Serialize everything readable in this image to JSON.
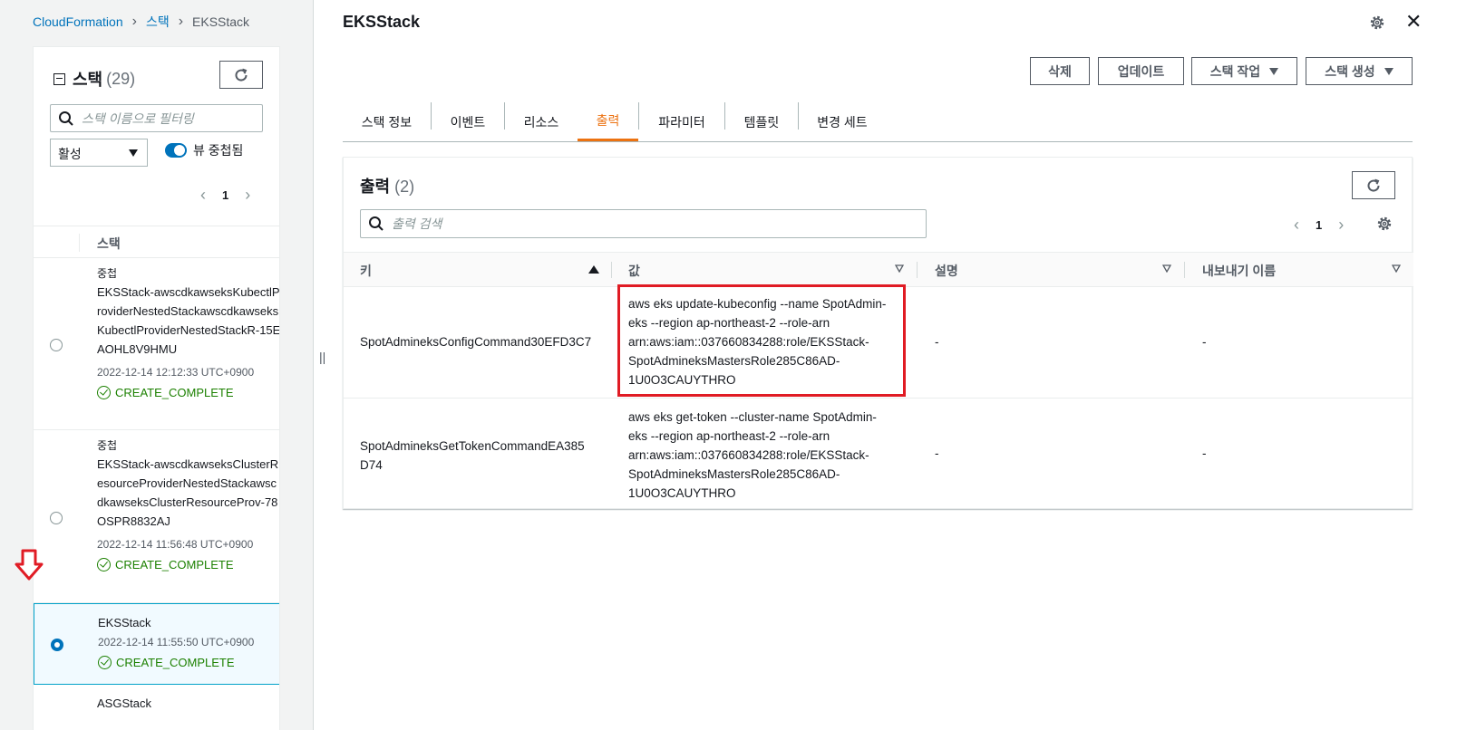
{
  "breadcrumb": {
    "root": "CloudFormation",
    "stacks": "스택",
    "current": "EKSStack"
  },
  "stack_panel": {
    "title": "스택",
    "count": "(29)",
    "search_placeholder": "스택 이름으로 필터링",
    "filter_value": "활성",
    "toggle_label": "뷰 중첩됨",
    "page": "1",
    "column_header": "스택",
    "rows": [
      {
        "tag": "중첩",
        "name": "EKSStack-awscdkawseksKubectlProviderNestedStackawscdkawseksKubectlProviderNestedStackR-15EAOHL8V9HMU",
        "time": "2022-12-14 12:12:33 UTC+0900",
        "status": "CREATE_COMPLETE"
      },
      {
        "tag": "중첩",
        "name": "EKSStack-awscdkawseksClusterResourceProviderNestedStackawscdkawseksClusterResourceProv-78OSPR8832AJ",
        "time": "2022-12-14 11:56:48 UTC+0900",
        "status": "CREATE_COMPLETE"
      },
      {
        "tag": "",
        "name": "EKSStack",
        "time": "2022-12-14 11:55:50 UTC+0900",
        "status": "CREATE_COMPLETE"
      },
      {
        "tag": "",
        "name": "ASGStack",
        "time": "",
        "status": ""
      }
    ]
  },
  "detail": {
    "title": "EKSStack",
    "buttons": {
      "delete": "삭제",
      "update": "업데이트",
      "stack_actions": "스택 작업",
      "create_stack": "스택 생성"
    },
    "tabs": [
      "스택 정보",
      "이벤트",
      "리소스",
      "출력",
      "파라미터",
      "템플릿",
      "변경 세트"
    ],
    "active_tab": "출력"
  },
  "outputs": {
    "title": "출력",
    "count": "(2)",
    "search_placeholder": "출력 검색",
    "page": "1",
    "columns": {
      "key": "키",
      "value": "값",
      "description": "설명",
      "export": "내보내기 이름"
    },
    "rows": [
      {
        "key": "SpotAdmineksConfigCommand30EFD3C7",
        "value_lines": [
          "aws eks update-kubeconfig --name SpotAdmin-",
          "eks --region ap-northeast-2 --role-arn",
          "arn:aws:iam::037660834288:role/EKSStack-",
          "SpotAdmineksMastersRole285C86AD-",
          "1U0O3CAUYTHRO"
        ],
        "description": "-",
        "export": "-"
      },
      {
        "key_lines": [
          "SpotAdmineksGetTokenCommandEA385",
          "D74"
        ],
        "value_lines": [
          "aws eks get-token --cluster-name SpotAdmin-",
          "eks --region ap-northeast-2 --role-arn",
          "arn:aws:iam::037660834288:role/EKSStack-",
          "SpotAdmineksMastersRole285C86AD-",
          "1U0O3CAUYTHRO"
        ],
        "description": "-",
        "export": "-"
      }
    ]
  },
  "colors": {
    "link": "#0073bb",
    "active_tab": "#ec7211",
    "success": "#1d8102",
    "highlight": "#e01b24"
  }
}
